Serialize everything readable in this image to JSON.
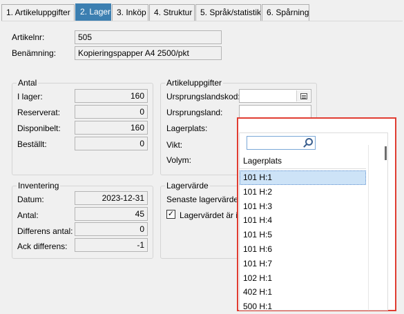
{
  "tabs": [
    {
      "label": "1. Artikeluppgifter",
      "active": false
    },
    {
      "label": "2. Lager",
      "active": true
    },
    {
      "label": "3. Inköp",
      "active": false
    },
    {
      "label": "4. Struktur",
      "active": false
    },
    {
      "label": "5. Språk/statistik",
      "active": false
    },
    {
      "label": "6. Spårning",
      "active": false
    }
  ],
  "article": {
    "number_label": "Artikelnr:",
    "number_value": "505",
    "name_label": "Benämning:",
    "name_value": "Kopieringspapper A4 2500/pkt"
  },
  "antal": {
    "title": "Antal",
    "i_lager_label": "I lager:",
    "i_lager_value": "160",
    "reserverat_label": "Reserverat:",
    "reserverat_value": "0",
    "disponibelt_label": "Disponibelt:",
    "disponibelt_value": "160",
    "bestallt_label": "Beställt:",
    "bestallt_value": "0"
  },
  "inventering": {
    "title": "Inventering",
    "datum_label": "Datum:",
    "datum_value": "2023-12-31",
    "antal_label": "Antal:",
    "antal_value": "45",
    "differens_label": "Differens antal:",
    "differens_value": "0",
    "ack_label": "Ack differens:",
    "ack_value": "-1"
  },
  "artikeluppgifter": {
    "title": "Artikeluppgifter",
    "ursprungslandskod_label": "Ursprungslandskod:",
    "ursprungsland_label": "Ursprungsland:",
    "lagerplats_label": "Lagerplats:",
    "vikt_label": "Vikt:",
    "volym_label": "Volym:"
  },
  "lagervarde": {
    "title": "Lagervärde",
    "senaste_label": "Senaste lagervärde:",
    "checkbox_label": "Lagervärdet är ina",
    "checkbox_checked": true
  },
  "dropdown": {
    "search_value": "",
    "header": "Lagerplats",
    "items": [
      "101 H:1",
      "101 H:2",
      "101 H:3",
      "101 H:4",
      "101 H:5",
      "101 H:6",
      "101 H:7",
      "102 H:1",
      "402 H:1",
      "500 H:1"
    ],
    "selected_index": 0,
    "highlight_color": "#e03c31"
  }
}
